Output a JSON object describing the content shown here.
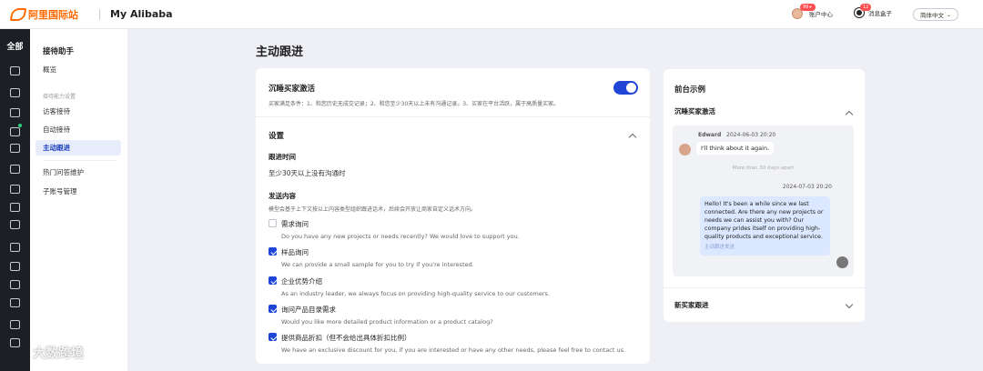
{
  "topbar": {
    "logo_text": "阿里国际站",
    "app_title": "My Alibaba",
    "account_label": "账户中心",
    "account_badge": "99+",
    "message_label": "消息盒子",
    "message_badge": "12",
    "language": "简体中文"
  },
  "rail": {
    "all_label": "全部"
  },
  "sidebar": {
    "heading": "接待助手",
    "overview": "概览",
    "group_label": "接待能力设置",
    "items": [
      "访客接待",
      "自动接待",
      "主动跟进"
    ],
    "active_item": "主动跟进",
    "extra_items": [
      "热门问答维护",
      "子账号管理"
    ]
  },
  "main": {
    "page_title": "主动跟进",
    "reactivate": {
      "title": "沉睡买家激活",
      "desc": "买家满足条件：1、和您历史无成交记录；2、和您至少30天以上未有沟通记录。3、买家在平台活跃，属于高质量买家。",
      "enabled": true
    },
    "settings": {
      "title": "设置",
      "time_label": "跟进时间",
      "time_value": "至少30天以上没有沟通时",
      "content_label": "发送内容",
      "content_desc": "模型会基于上下文按以上内容类型组织跟进话术，后续会开放让商家自定义话术方向。",
      "options": [
        {
          "label": "需求询问",
          "desc": "Do you have any new projects or needs recently? We would love to support you.",
          "checked": false
        },
        {
          "label": "样品询问",
          "desc": "We can provide a small sample for you to try if you're interested.",
          "checked": true
        },
        {
          "label": "企业优势介绍",
          "desc": "As an industry leader, we always focus on providing high-quality service to our customers.",
          "checked": true
        },
        {
          "label": "询问产品目录需求",
          "desc": "Would you like more detailed product information or a product catalog?",
          "checked": true
        },
        {
          "label": "提供商品折扣（但不会给出具体折扣比例）",
          "desc": "We have an exclusive discount for you, if you are interested or have any other needs, please feel free to contact us.",
          "checked": true
        }
      ]
    }
  },
  "preview": {
    "title": "前台示例",
    "section1": "沉睡买家激活",
    "buyer_name": "Edward",
    "buyer_time": "2024-06-03 20:20",
    "buyer_msg": "I'll think about it again.",
    "gap_note": "More than 30 days apart",
    "seller_time": "2024-07-03 20:20",
    "seller_msg": "Hello! It's been a while since we last connected. Are there any new projects or needs we can assist you with? Our company prides itself on providing high-quality products and exceptional service.",
    "seller_note": "主动跟进发送",
    "section2": "新买家跟进"
  },
  "watermark": "大数跨境"
}
